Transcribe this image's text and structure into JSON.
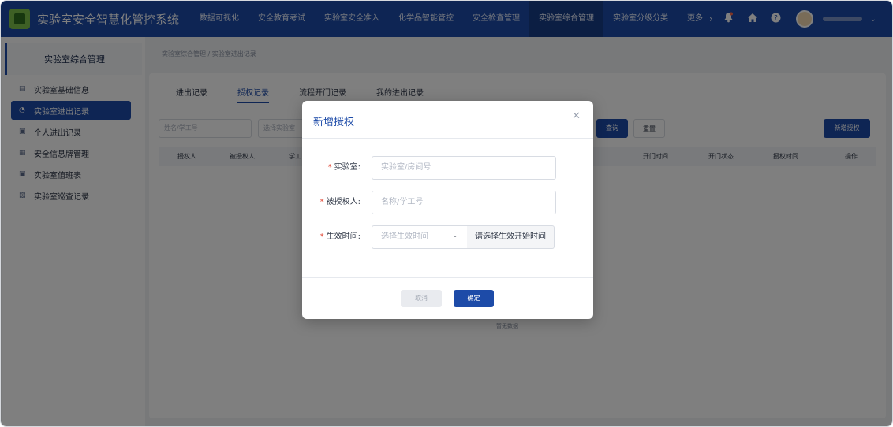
{
  "app": {
    "title": "实验室安全智慧化管控系统",
    "accent_color": "#1d4ba8"
  },
  "topnav": {
    "items": [
      {
        "label": "数据可视化"
      },
      {
        "label": "安全教育考试"
      },
      {
        "label": "实验室安全准入"
      },
      {
        "label": "化学品智能管控"
      },
      {
        "label": "安全检查管理"
      },
      {
        "label": "实验室综合管理",
        "active": true
      },
      {
        "label": "实验室分级分类"
      }
    ],
    "more_label": "更多",
    "icons": [
      "bell-icon",
      "home-icon",
      "help-icon"
    ]
  },
  "sidebar": {
    "header": "实验室综合管理",
    "items": [
      {
        "label": "实验室基础信息",
        "icon": "document-icon"
      },
      {
        "label": "实验室进出记录",
        "icon": "record-icon",
        "active": true
      },
      {
        "label": "个人进出记录",
        "icon": "person-record-icon"
      },
      {
        "label": "安全信息牌管理",
        "icon": "card-icon"
      },
      {
        "label": "实验室值班表",
        "icon": "schedule-icon"
      },
      {
        "label": "实验室巡查记录",
        "icon": "inspect-icon"
      }
    ]
  },
  "breadcrumb": {
    "text": "实验室综合管理  /  实验室进出记录"
  },
  "tabs": [
    {
      "label": "进出记录"
    },
    {
      "label": "授权记录",
      "active": true
    },
    {
      "label": "流程开门记录"
    },
    {
      "label": "我的进出记录"
    }
  ],
  "filters": {
    "user_placeholder": "姓名/学工号",
    "lab_placeholder": "选择实验室",
    "search_label": "查询",
    "reset_label": "重置",
    "add_label": "新增授权"
  },
  "table": {
    "columns": [
      "授权人",
      "被授权人",
      "学工",
      "开门时间",
      "开门状态",
      "授权时间",
      "操作"
    ],
    "empty_text": "暂无数据"
  },
  "modal": {
    "title": "新增授权",
    "fields": [
      {
        "label": "实验室:",
        "placeholder": "实验室/房间号",
        "required": true
      },
      {
        "label": "被授权人:",
        "placeholder": "名称/学工号",
        "required": true
      },
      {
        "label": "生效时间:",
        "placeholder": "选择生效时间",
        "required": true,
        "separator": "-",
        "hint": "请选择生效开始时间"
      }
    ],
    "cancel_label": "取消",
    "confirm_label": "确定"
  }
}
